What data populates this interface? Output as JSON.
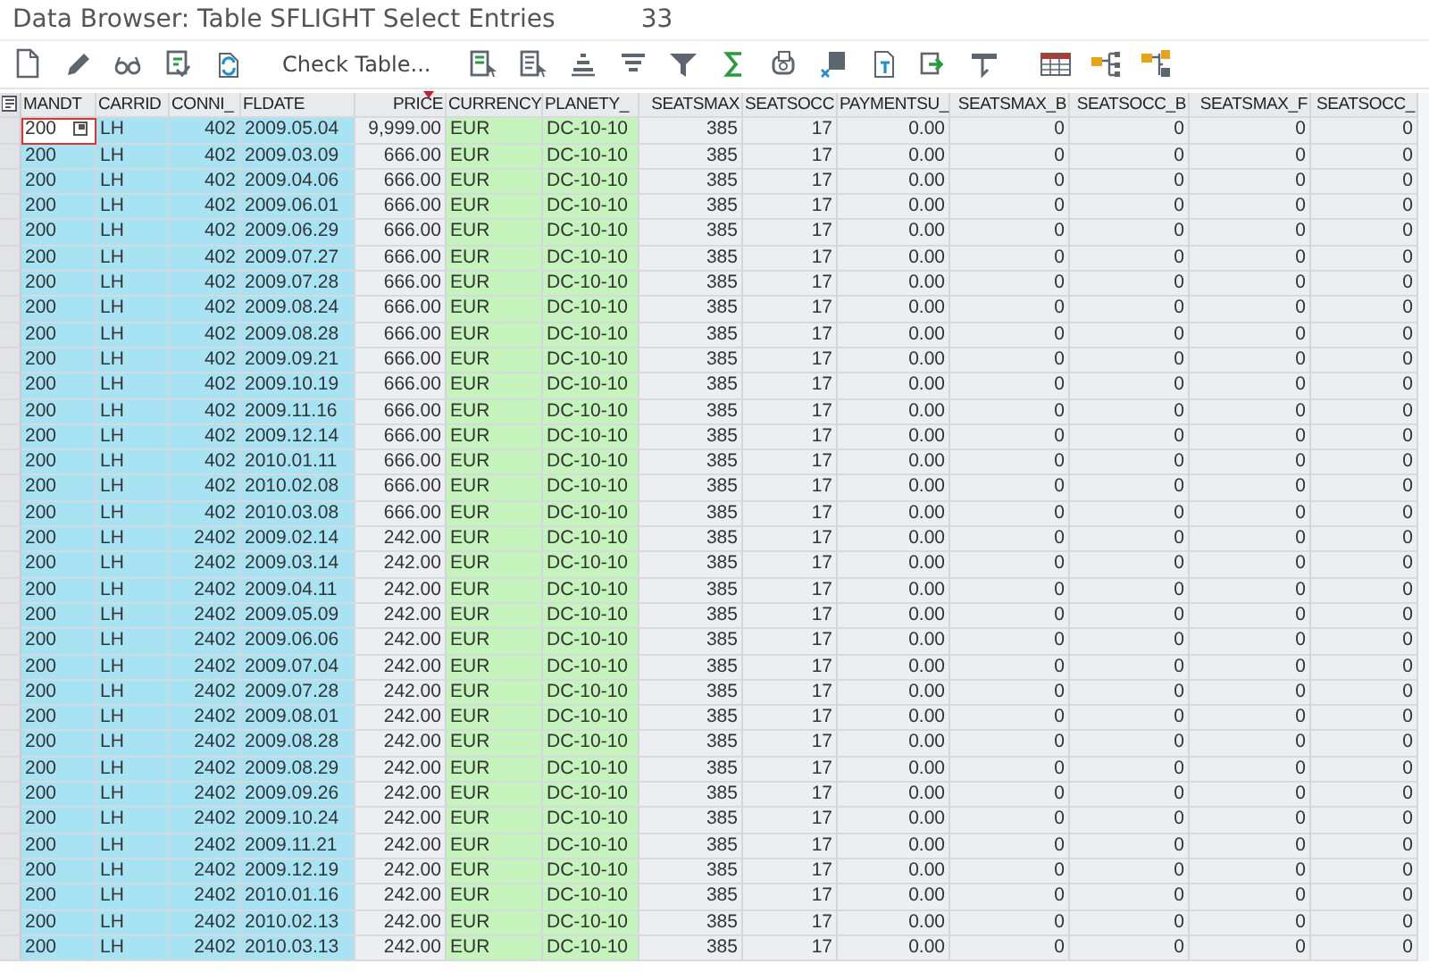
{
  "window": {
    "title": "Data Browser: Table SFLIGHT Select Entries",
    "entry_count": "33"
  },
  "toolbar": {
    "check_table": "Check Table..."
  },
  "table": {
    "columns": [
      {
        "label": "MANDT",
        "kind": "key",
        "numeric": false
      },
      {
        "label": "CARRID",
        "kind": "key",
        "numeric": false
      },
      {
        "label": "CONNI_",
        "kind": "key",
        "numeric": true
      },
      {
        "label": "FLDATE",
        "kind": "key",
        "numeric": false
      },
      {
        "label": "PRICE",
        "kind": "plain",
        "numeric": true
      },
      {
        "label": "CURRENCY",
        "kind": "ref",
        "numeric": false
      },
      {
        "label": "PLANETY_",
        "kind": "ref",
        "numeric": false
      },
      {
        "label": "SEATSMAX",
        "kind": "plain",
        "numeric": true
      },
      {
        "label": "SEATSOCC",
        "kind": "plain",
        "numeric": true
      },
      {
        "label": "PAYMENTSU_",
        "kind": "plain",
        "numeric": true
      },
      {
        "label": "SEATSMAX_B",
        "kind": "plain",
        "numeric": true
      },
      {
        "label": "SEATSOCC_B",
        "kind": "plain",
        "numeric": true
      },
      {
        "label": "SEATSMAX_F",
        "kind": "plain",
        "numeric": true
      },
      {
        "label": "SEATSOCC_",
        "kind": "plain",
        "numeric": true
      }
    ],
    "rows": [
      {
        "focused": true,
        "cells": [
          "200",
          "LH",
          "402",
          "2009.05.04",
          "9,999.00",
          "EUR",
          "DC-10-10",
          "385",
          "17",
          "0.00",
          "0",
          "0",
          "0",
          "0"
        ]
      },
      {
        "focused": false,
        "cells": [
          "200",
          "LH",
          "402",
          "2009.03.09",
          "666.00",
          "EUR",
          "DC-10-10",
          "385",
          "17",
          "0.00",
          "0",
          "0",
          "0",
          "0"
        ]
      },
      {
        "focused": false,
        "cells": [
          "200",
          "LH",
          "402",
          "2009.04.06",
          "666.00",
          "EUR",
          "DC-10-10",
          "385",
          "17",
          "0.00",
          "0",
          "0",
          "0",
          "0"
        ]
      },
      {
        "focused": false,
        "cells": [
          "200",
          "LH",
          "402",
          "2009.06.01",
          "666.00",
          "EUR",
          "DC-10-10",
          "385",
          "17",
          "0.00",
          "0",
          "0",
          "0",
          "0"
        ]
      },
      {
        "focused": false,
        "cells": [
          "200",
          "LH",
          "402",
          "2009.06.29",
          "666.00",
          "EUR",
          "DC-10-10",
          "385",
          "17",
          "0.00",
          "0",
          "0",
          "0",
          "0"
        ]
      },
      {
        "focused": false,
        "cells": [
          "200",
          "LH",
          "402",
          "2009.07.27",
          "666.00",
          "EUR",
          "DC-10-10",
          "385",
          "17",
          "0.00",
          "0",
          "0",
          "0",
          "0"
        ]
      },
      {
        "focused": false,
        "cells": [
          "200",
          "LH",
          "402",
          "2009.07.28",
          "666.00",
          "EUR",
          "DC-10-10",
          "385",
          "17",
          "0.00",
          "0",
          "0",
          "0",
          "0"
        ]
      },
      {
        "focused": false,
        "cells": [
          "200",
          "LH",
          "402",
          "2009.08.24",
          "666.00",
          "EUR",
          "DC-10-10",
          "385",
          "17",
          "0.00",
          "0",
          "0",
          "0",
          "0"
        ]
      },
      {
        "focused": false,
        "cells": [
          "200",
          "LH",
          "402",
          "2009.08.28",
          "666.00",
          "EUR",
          "DC-10-10",
          "385",
          "17",
          "0.00",
          "0",
          "0",
          "0",
          "0"
        ]
      },
      {
        "focused": false,
        "cells": [
          "200",
          "LH",
          "402",
          "2009.09.21",
          "666.00",
          "EUR",
          "DC-10-10",
          "385",
          "17",
          "0.00",
          "0",
          "0",
          "0",
          "0"
        ]
      },
      {
        "focused": false,
        "cells": [
          "200",
          "LH",
          "402",
          "2009.10.19",
          "666.00",
          "EUR",
          "DC-10-10",
          "385",
          "17",
          "0.00",
          "0",
          "0",
          "0",
          "0"
        ]
      },
      {
        "focused": false,
        "cells": [
          "200",
          "LH",
          "402",
          "2009.11.16",
          "666.00",
          "EUR",
          "DC-10-10",
          "385",
          "17",
          "0.00",
          "0",
          "0",
          "0",
          "0"
        ]
      },
      {
        "focused": false,
        "cells": [
          "200",
          "LH",
          "402",
          "2009.12.14",
          "666.00",
          "EUR",
          "DC-10-10",
          "385",
          "17",
          "0.00",
          "0",
          "0",
          "0",
          "0"
        ]
      },
      {
        "focused": false,
        "cells": [
          "200",
          "LH",
          "402",
          "2010.01.11",
          "666.00",
          "EUR",
          "DC-10-10",
          "385",
          "17",
          "0.00",
          "0",
          "0",
          "0",
          "0"
        ]
      },
      {
        "focused": false,
        "cells": [
          "200",
          "LH",
          "402",
          "2010.02.08",
          "666.00",
          "EUR",
          "DC-10-10",
          "385",
          "17",
          "0.00",
          "0",
          "0",
          "0",
          "0"
        ]
      },
      {
        "focused": false,
        "cells": [
          "200",
          "LH",
          "402",
          "2010.03.08",
          "666.00",
          "EUR",
          "DC-10-10",
          "385",
          "17",
          "0.00",
          "0",
          "0",
          "0",
          "0"
        ]
      },
      {
        "focused": false,
        "cells": [
          "200",
          "LH",
          "2402",
          "2009.02.14",
          "242.00",
          "EUR",
          "DC-10-10",
          "385",
          "17",
          "0.00",
          "0",
          "0",
          "0",
          "0"
        ]
      },
      {
        "focused": false,
        "cells": [
          "200",
          "LH",
          "2402",
          "2009.03.14",
          "242.00",
          "EUR",
          "DC-10-10",
          "385",
          "17",
          "0.00",
          "0",
          "0",
          "0",
          "0"
        ]
      },
      {
        "focused": false,
        "cells": [
          "200",
          "LH",
          "2402",
          "2009.04.11",
          "242.00",
          "EUR",
          "DC-10-10",
          "385",
          "17",
          "0.00",
          "0",
          "0",
          "0",
          "0"
        ]
      },
      {
        "focused": false,
        "cells": [
          "200",
          "LH",
          "2402",
          "2009.05.09",
          "242.00",
          "EUR",
          "DC-10-10",
          "385",
          "17",
          "0.00",
          "0",
          "0",
          "0",
          "0"
        ]
      },
      {
        "focused": false,
        "cells": [
          "200",
          "LH",
          "2402",
          "2009.06.06",
          "242.00",
          "EUR",
          "DC-10-10",
          "385",
          "17",
          "0.00",
          "0",
          "0",
          "0",
          "0"
        ]
      },
      {
        "focused": false,
        "cells": [
          "200",
          "LH",
          "2402",
          "2009.07.04",
          "242.00",
          "EUR",
          "DC-10-10",
          "385",
          "17",
          "0.00",
          "0",
          "0",
          "0",
          "0"
        ]
      },
      {
        "focused": false,
        "cells": [
          "200",
          "LH",
          "2402",
          "2009.07.28",
          "242.00",
          "EUR",
          "DC-10-10",
          "385",
          "17",
          "0.00",
          "0",
          "0",
          "0",
          "0"
        ]
      },
      {
        "focused": false,
        "cells": [
          "200",
          "LH",
          "2402",
          "2009.08.01",
          "242.00",
          "EUR",
          "DC-10-10",
          "385",
          "17",
          "0.00",
          "0",
          "0",
          "0",
          "0"
        ]
      },
      {
        "focused": false,
        "cells": [
          "200",
          "LH",
          "2402",
          "2009.08.28",
          "242.00",
          "EUR",
          "DC-10-10",
          "385",
          "17",
          "0.00",
          "0",
          "0",
          "0",
          "0"
        ]
      },
      {
        "focused": false,
        "cells": [
          "200",
          "LH",
          "2402",
          "2009.08.29",
          "242.00",
          "EUR",
          "DC-10-10",
          "385",
          "17",
          "0.00",
          "0",
          "0",
          "0",
          "0"
        ]
      },
      {
        "focused": false,
        "cells": [
          "200",
          "LH",
          "2402",
          "2009.09.26",
          "242.00",
          "EUR",
          "DC-10-10",
          "385",
          "17",
          "0.00",
          "0",
          "0",
          "0",
          "0"
        ]
      },
      {
        "focused": false,
        "cells": [
          "200",
          "LH",
          "2402",
          "2009.10.24",
          "242.00",
          "EUR",
          "DC-10-10",
          "385",
          "17",
          "0.00",
          "0",
          "0",
          "0",
          "0"
        ]
      },
      {
        "focused": false,
        "cells": [
          "200",
          "LH",
          "2402",
          "2009.11.21",
          "242.00",
          "EUR",
          "DC-10-10",
          "385",
          "17",
          "0.00",
          "0",
          "0",
          "0",
          "0"
        ]
      },
      {
        "focused": false,
        "cells": [
          "200",
          "LH",
          "2402",
          "2009.12.19",
          "242.00",
          "EUR",
          "DC-10-10",
          "385",
          "17",
          "0.00",
          "0",
          "0",
          "0",
          "0"
        ]
      },
      {
        "focused": false,
        "cells": [
          "200",
          "LH",
          "2402",
          "2010.01.16",
          "242.00",
          "EUR",
          "DC-10-10",
          "385",
          "17",
          "0.00",
          "0",
          "0",
          "0",
          "0"
        ]
      },
      {
        "focused": false,
        "cells": [
          "200",
          "LH",
          "2402",
          "2010.02.13",
          "242.00",
          "EUR",
          "DC-10-10",
          "385",
          "17",
          "0.00",
          "0",
          "0",
          "0",
          "0"
        ]
      },
      {
        "focused": false,
        "cells": [
          "200",
          "LH",
          "2402",
          "2010.03.13",
          "242.00",
          "EUR",
          "DC-10-10",
          "385",
          "17",
          "0.00",
          "0",
          "0",
          "0",
          "0"
        ]
      }
    ]
  }
}
